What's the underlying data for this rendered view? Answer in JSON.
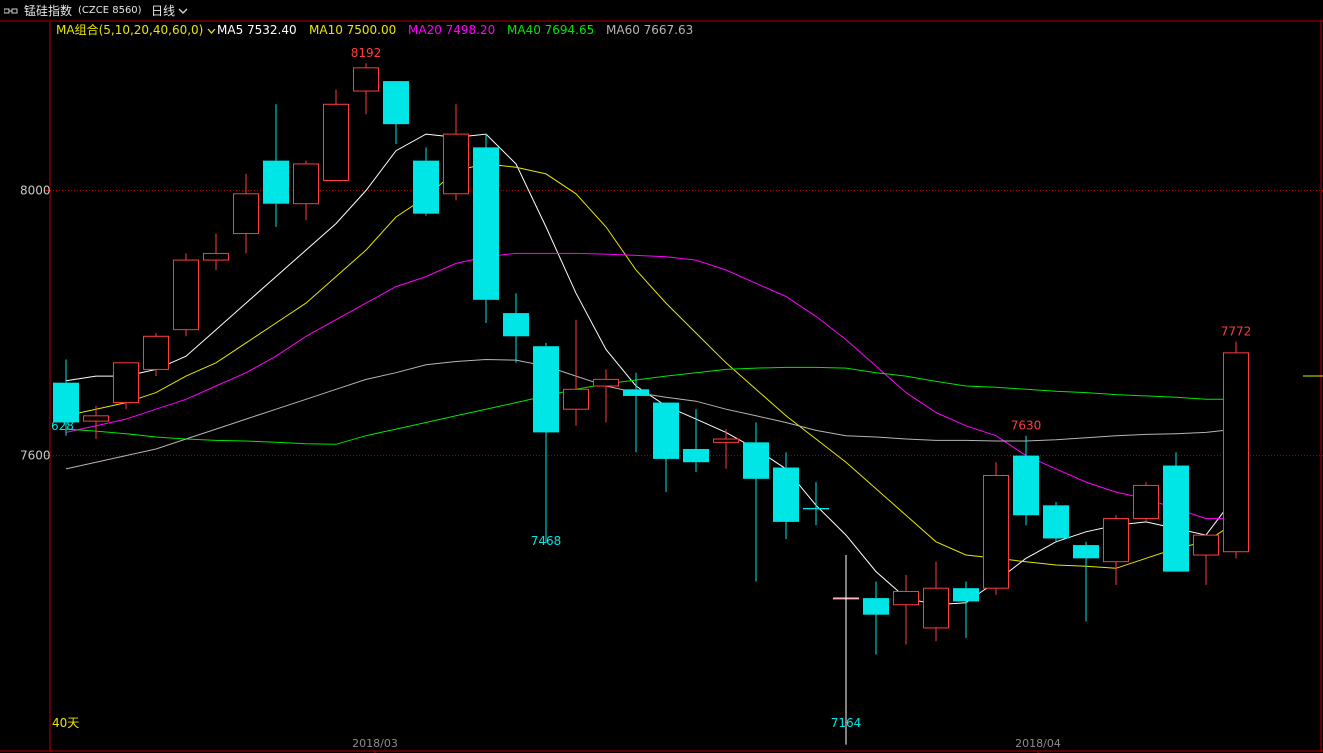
{
  "topbar": {
    "instrument": "锰硅指数",
    "code": "(CZCE 8560)",
    "period": "日线",
    "period_chevron_icon": "chevron-down-icon",
    "menu_icon": "window-menu-icon"
  },
  "ma_legend": {
    "group_label": "MA组合(5,10,20,40,60,0)",
    "group_color": "#e6e600",
    "chevron_icon": "chevron-down-icon",
    "items": [
      {
        "label": "MA5 7532.40",
        "color": "#ffffff"
      },
      {
        "label": "MA10 7500.00",
        "color": "#e6e600"
      },
      {
        "label": "MA20 7498.20",
        "color": "#ff00ff"
      },
      {
        "label": "MA40 7694.65",
        "color": "#00e600"
      },
      {
        "label": "MA60 7667.63",
        "color": "#b4b4b4"
      }
    ]
  },
  "colors": {
    "up": "#ff3c3c",
    "down": "#00e6e6",
    "axis": "#b40000",
    "text_axis": "#c8c8c8",
    "label_red": "#ff3c3c",
    "label_cyan": "#00e6e6",
    "bottom_label": "#e6e600"
  },
  "labels": {
    "period_days": "40天",
    "left_cut": "628"
  },
  "chart_data": {
    "type": "candlestick",
    "y_ticks": [
      8000,
      7600
    ],
    "x_ticks": [
      "2018/03",
      "2018/04"
    ],
    "ylim": [
      7180,
      8230
    ],
    "annotations": [
      {
        "text": "8192",
        "index": 10,
        "value": 8192,
        "kind": "high"
      },
      {
        "text": "7468",
        "index": 16,
        "value": 7468,
        "kind": "low"
      },
      {
        "text": "7164",
        "index": 26,
        "value": 7164,
        "kind": "low"
      },
      {
        "text": "7630",
        "index": 32,
        "value": 7630,
        "kind": "high"
      },
      {
        "text": "7772",
        "index": 39,
        "value": 7772,
        "kind": "high"
      }
    ],
    "candles": [
      {
        "o": 7710,
        "h": 7745,
        "l": 7630,
        "c": 7650
      },
      {
        "o": 7652,
        "h": 7675,
        "l": 7625,
        "c": 7660
      },
      {
        "o": 7680,
        "h": 7740,
        "l": 7670,
        "c": 7740
      },
      {
        "o": 7730,
        "h": 7785,
        "l": 7720,
        "c": 7780
      },
      {
        "o": 7790,
        "h": 7905,
        "l": 7780,
        "c": 7895
      },
      {
        "o": 7895,
        "h": 7935,
        "l": 7880,
        "c": 7905
      },
      {
        "o": 7935,
        "h": 8025,
        "l": 7905,
        "c": 7995
      },
      {
        "o": 8045,
        "h": 8130,
        "l": 7945,
        "c": 7980
      },
      {
        "o": 7980,
        "h": 8045,
        "l": 7955,
        "c": 8040
      },
      {
        "o": 8015,
        "h": 8152,
        "l": 8015,
        "c": 8130
      },
      {
        "o": 8150,
        "h": 8192,
        "l": 8115,
        "c": 8185
      },
      {
        "o": 8165,
        "h": 8165,
        "l": 8070,
        "c": 8100
      },
      {
        "o": 8045,
        "h": 8065,
        "l": 7962,
        "c": 7965
      },
      {
        "o": 7995,
        "h": 8130,
        "l": 7985,
        "c": 8085
      },
      {
        "o": 8065,
        "h": 8085,
        "l": 7800,
        "c": 7835
      },
      {
        "o": 7815,
        "h": 7845,
        "l": 7740,
        "c": 7780
      },
      {
        "o": 7765,
        "h": 7770,
        "l": 7468,
        "c": 7635
      },
      {
        "o": 7670,
        "h": 7805,
        "l": 7645,
        "c": 7700
      },
      {
        "o": 7705,
        "h": 7730,
        "l": 7650,
        "c": 7715
      },
      {
        "o": 7700,
        "h": 7725,
        "l": 7605,
        "c": 7690
      },
      {
        "o": 7680,
        "h": 7680,
        "l": 7545,
        "c": 7595
      },
      {
        "o": 7610,
        "h": 7670,
        "l": 7575,
        "c": 7590
      },
      {
        "o": 7620,
        "h": 7640,
        "l": 7580,
        "c": 7625
      },
      {
        "o": 7620,
        "h": 7650,
        "l": 7410,
        "c": 7565
      },
      {
        "o": 7582,
        "h": 7605,
        "l": 7474,
        "c": 7500
      },
      {
        "o": 7521,
        "h": 7560,
        "l": 7495,
        "c": 7519
      },
      {
        "o": 7385,
        "h": 7450,
        "l": 7164,
        "c": 7385
      },
      {
        "o": 7385,
        "h": 7410,
        "l": 7300,
        "c": 7360
      },
      {
        "o": 7375,
        "h": 7420,
        "l": 7315,
        "c": 7395
      },
      {
        "o": 7340,
        "h": 7440,
        "l": 7320,
        "c": 7400
      },
      {
        "o": 7400,
        "h": 7410,
        "l": 7325,
        "c": 7380
      },
      {
        "o": 7400,
        "h": 7590,
        "l": 7390,
        "c": 7570
      },
      {
        "o": 7600,
        "h": 7630,
        "l": 7495,
        "c": 7510
      },
      {
        "o": 7525,
        "h": 7530,
        "l": 7470,
        "c": 7475
      },
      {
        "o": 7465,
        "h": 7470,
        "l": 7350,
        "c": 7445
      },
      {
        "o": 7440,
        "h": 7510,
        "l": 7405,
        "c": 7505
      },
      {
        "o": 7505,
        "h": 7560,
        "l": 7500,
        "c": 7555
      },
      {
        "o": 7585,
        "h": 7605,
        "l": 7430,
        "c": 7425
      },
      {
        "o": 7450,
        "h": 7475,
        "l": 7405,
        "c": 7480
      },
      {
        "o": 7455,
        "h": 7772,
        "l": 7445,
        "c": 7755
      }
    ],
    "series": [
      {
        "name": "MA5",
        "color": "#ffffff",
        "values": [
          7713,
          7720,
          7720,
          7730,
          7750,
          7790,
          7830,
          7870,
          7910,
          7950,
          8000,
          8060,
          8085,
          8080,
          8085,
          8040,
          7945,
          7845,
          7760,
          7705,
          7675,
          7655,
          7635,
          7610,
          7580,
          7525,
          7480,
          7425,
          7385,
          7375,
          7378,
          7410,
          7445,
          7470,
          7485,
          7495,
          7500,
          7490,
          7480,
          7540
        ]
      },
      {
        "name": "MA10",
        "color": "#e6e600",
        "values": [
          7660,
          7670,
          7680,
          7695,
          7720,
          7740,
          7770,
          7800,
          7830,
          7870,
          7910,
          7960,
          7990,
          8030,
          8040,
          8035,
          8025,
          7995,
          7945,
          7880,
          7830,
          7785,
          7740,
          7700,
          7660,
          7625,
          7590,
          7550,
          7510,
          7470,
          7450,
          7445,
          7440,
          7435,
          7433,
          7430,
          7445,
          7460,
          7470,
          7500
        ]
      },
      {
        "name": "MA20",
        "color": "#ff00ff",
        "values": [
          7635,
          7645,
          7655,
          7670,
          7685,
          7705,
          7725,
          7750,
          7780,
          7805,
          7830,
          7855,
          7870,
          7890,
          7900,
          7905,
          7905,
          7905,
          7904,
          7902,
          7900,
          7895,
          7880,
          7860,
          7840,
          7810,
          7775,
          7735,
          7695,
          7665,
          7645,
          7630,
          7600,
          7580,
          7560,
          7545,
          7535,
          7520,
          7505,
          7505
        ]
      },
      {
        "name": "MA40",
        "color": "#00e600",
        "values": [
          7640,
          7637,
          7633,
          7628,
          7625,
          7623,
          7622,
          7620,
          7618,
          7617,
          7630,
          7640,
          7650,
          7660,
          7670,
          7680,
          7690,
          7700,
          7708,
          7714,
          7720,
          7725,
          7730,
          7732,
          7733,
          7733,
          7732,
          7725,
          7720,
          7712,
          7705,
          7703,
          7700,
          7697,
          7695,
          7692,
          7690,
          7688,
          7685,
          7685
        ]
      },
      {
        "name": "MA60",
        "color": "#b4b4b4",
        "values": [
          7580,
          7590,
          7600,
          7610,
          7625,
          7640,
          7655,
          7670,
          7685,
          7700,
          7715,
          7725,
          7737,
          7742,
          7745,
          7744,
          7735,
          7720,
          7705,
          7695,
          7688,
          7682,
          7670,
          7660,
          7650,
          7638,
          7630,
          7628,
          7625,
          7623,
          7623,
          7622,
          7622,
          7624,
          7627,
          7630,
          7632,
          7633,
          7635,
          7640
        ]
      }
    ]
  }
}
